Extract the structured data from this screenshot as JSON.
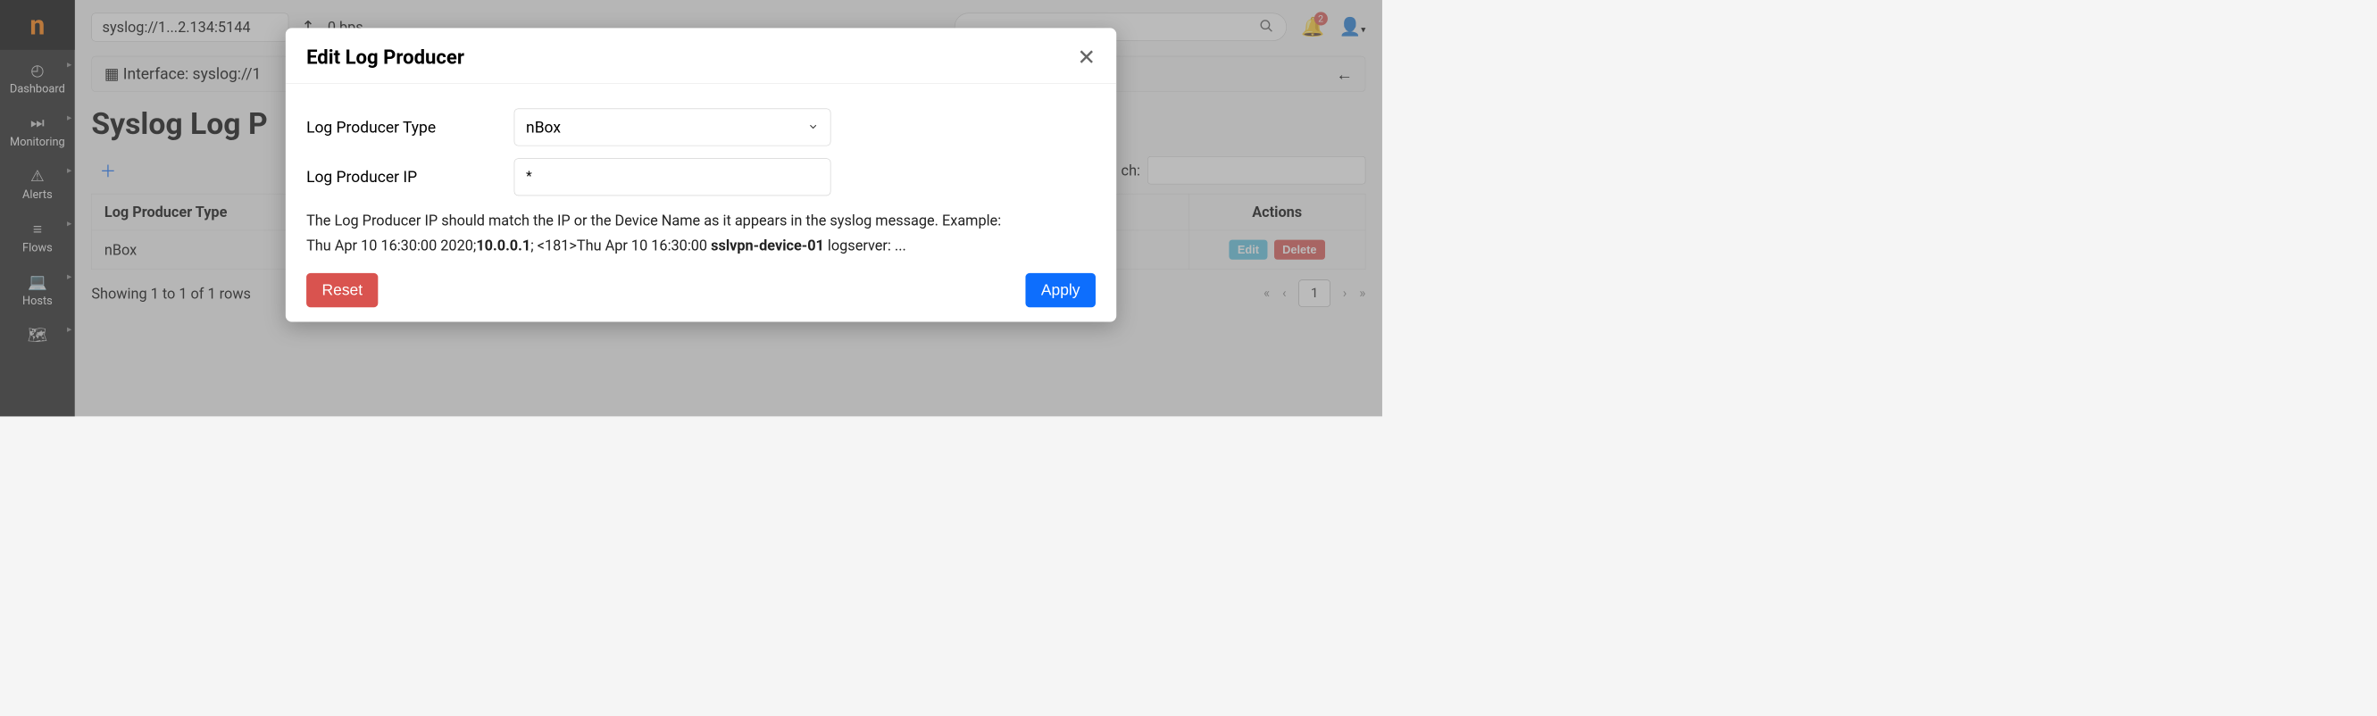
{
  "sidebar": {
    "items": [
      {
        "label": "Dashboard"
      },
      {
        "label": "Monitoring"
      },
      {
        "label": "Alerts"
      },
      {
        "label": "Flows"
      },
      {
        "label": "Hosts"
      }
    ]
  },
  "topbar": {
    "address": "syslog://1...2.134:5144",
    "bps": "0 bps",
    "notification_count": "2"
  },
  "interface_bar": {
    "label": "Interface: syslog://1"
  },
  "page": {
    "title": "Syslog Log P",
    "search_label": "ch:"
  },
  "table": {
    "headers": {
      "type": "Log Producer Type",
      "actions": "Actions"
    },
    "rows": [
      {
        "type": "nBox"
      }
    ],
    "edit_label": "Edit",
    "delete_label": "Delete",
    "rows_info": "Showing 1 to 1 of 1 rows"
  },
  "pagination": {
    "first": "«",
    "prev": "‹",
    "current": "1",
    "next": "›",
    "last": "»"
  },
  "modal": {
    "title": "Edit Log Producer",
    "type_label": "Log Producer Type",
    "type_value": "nBox",
    "ip_label": "Log Producer IP",
    "ip_value": "*",
    "help_intro": "The Log Producer IP should match the IP or the Device Name as it appears in the syslog message. Example:",
    "help_ex_prefix": "Thu Apr 10 16:30:00 2020;",
    "help_ex_ip": "10.0.0.1",
    "help_ex_mid": "; <181>Thu Apr 10 16:30:00 ",
    "help_ex_dev": "sslvpn-device-01",
    "help_ex_suffix": " logserver: ...",
    "reset_label": "Reset",
    "apply_label": "Apply"
  }
}
